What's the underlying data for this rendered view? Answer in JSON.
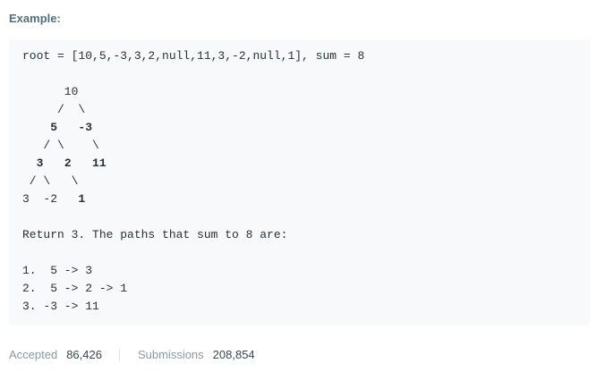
{
  "heading": "Example:",
  "example": {
    "input_line": "root = [10,5,-3,3,2,null,11,3,-2,null,1], sum = 8",
    "tree": {
      "row1": "      10",
      "row2": "     /  \\",
      "row3_lead": "    ",
      "row3_bold": "5   -3",
      "row4": "   / \\    \\",
      "row5_lead": "  ",
      "row5_bold": "3   2   11",
      "row6": " / \\   \\",
      "row7_plain": "3  -2   ",
      "row7_bold": "1"
    },
    "return_line": "Return 3. The paths that sum to 8 are:",
    "paths": [
      "1.  5 -> 3",
      "2.  5 -> 2 -> 1",
      "3. -3 -> 11"
    ]
  },
  "stats": {
    "accepted_label": "Accepted",
    "accepted_value": "86,426",
    "submissions_label": "Submissions",
    "submissions_value": "208,854"
  }
}
